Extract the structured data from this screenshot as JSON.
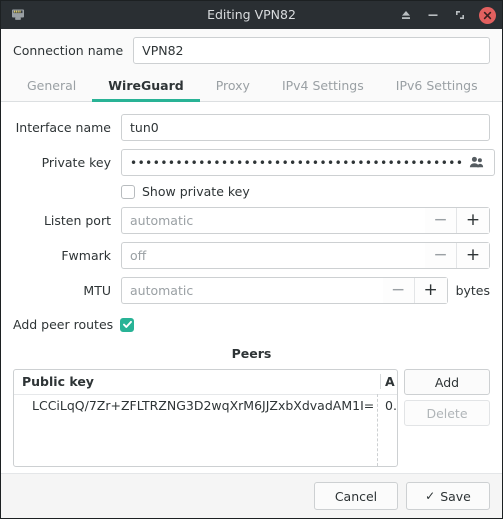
{
  "titlebar": {
    "title": "Editing VPN82",
    "app_icon": "network-port-icon",
    "buttons": [
      {
        "name": "unstick-icon",
        "glyph": "⏏"
      },
      {
        "name": "minimize-icon",
        "glyph": "−"
      },
      {
        "name": "maximize-icon",
        "glyph": "⤡"
      },
      {
        "name": "close-icon",
        "glyph": "✕"
      }
    ],
    "close_color": "#e2605f",
    "bg_color": "#2a2f33"
  },
  "connection": {
    "label": "Connection name",
    "value": "VPN82",
    "placeholder": "Connection name"
  },
  "tabs": [
    {
      "label": "General",
      "active": false
    },
    {
      "label": "WireGuard",
      "active": true
    },
    {
      "label": "Proxy",
      "active": false
    },
    {
      "label": "IPv4 Settings",
      "active": false
    },
    {
      "label": "IPv6 Settings",
      "active": false
    }
  ],
  "accent_color": "#29b396",
  "form": {
    "interface_name": {
      "label": "Interface name",
      "value": "tun0",
      "placeholder": "tun0"
    },
    "private_key": {
      "label": "Private key",
      "value": "••••••••••••••••••••••••••••••••••••••••••••",
      "placeholder": "Private key",
      "icon": "contacts-icon"
    },
    "show_private_key": {
      "label": "Show private key",
      "checked": false
    },
    "listen_port": {
      "label": "Listen port",
      "value": "automatic",
      "placeholder": "automatic",
      "minus": "−",
      "plus": "+"
    },
    "fwmark": {
      "label": "Fwmark",
      "value": "off",
      "placeholder": "off",
      "minus": "−",
      "plus": "+"
    },
    "mtu": {
      "label": "MTU",
      "value": "automatic",
      "placeholder": "automatic",
      "minus": "−",
      "plus": "+",
      "units": "bytes"
    },
    "add_peer_routes": {
      "label": "Add peer routes",
      "checked": true
    }
  },
  "peers": {
    "title": "Peers",
    "columns": [
      "Public key",
      "A"
    ],
    "rows": [
      {
        "public_key": "LCCiLqQ/7Zr+ZFLTRZNG3D2wqXrM6JJZxbXdvadAM1I=",
        "allowed_ips": "0."
      }
    ],
    "add_label": "Add",
    "delete_label": "Delete",
    "delete_enabled": false
  },
  "footer": {
    "cancel_label": "Cancel",
    "save_label": "Save",
    "save_check": "✓"
  }
}
